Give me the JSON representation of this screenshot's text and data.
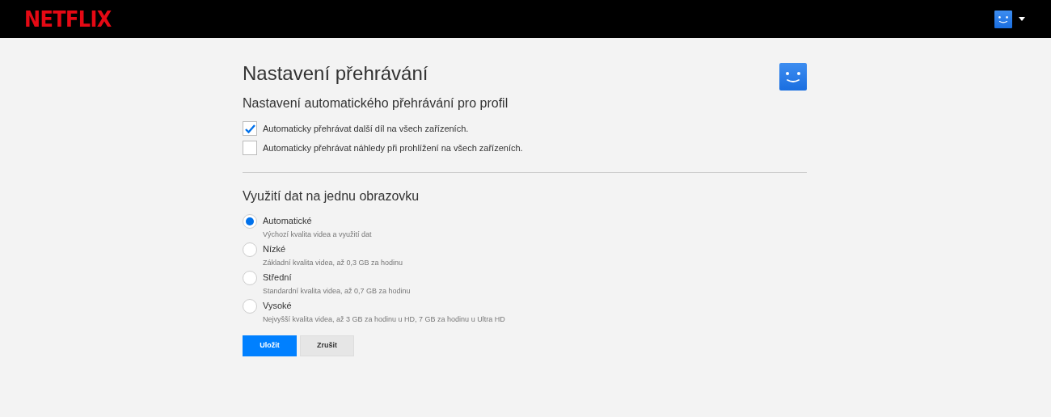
{
  "header": {
    "logo": "NETFLIX"
  },
  "page": {
    "title": "Nastavení přehrávání",
    "autoplay": {
      "heading": "Nastavení automatického přehrávání pro profil",
      "options": [
        {
          "label": "Automaticky přehrávat další díl na všech zařízeních.",
          "checked": true
        },
        {
          "label": "Automaticky přehrávat náhledy při prohlížení na všech zařízeních.",
          "checked": false
        }
      ]
    },
    "data_usage": {
      "heading": "Využití dat na jednu obrazovku",
      "options": [
        {
          "label": "Automatické",
          "description": "Výchozí kvalita videa a využití dat",
          "selected": true
        },
        {
          "label": "Nízké",
          "description": "Základní kvalita videa, až 0,3 GB za hodinu",
          "selected": false
        },
        {
          "label": "Střední",
          "description": "Standardní kvalita videa, až 0,7 GB za hodinu",
          "selected": false
        },
        {
          "label": "Vysoké",
          "description": "Nejvyšší kvalita videa, až 3 GB za hodinu u HD, 7 GB za hodinu u Ultra HD",
          "selected": false
        }
      ]
    },
    "buttons": [
      {
        "label": "Uložit",
        "kind": "primary"
      },
      {
        "label": "Zrušit",
        "kind": "secondary"
      }
    ]
  }
}
